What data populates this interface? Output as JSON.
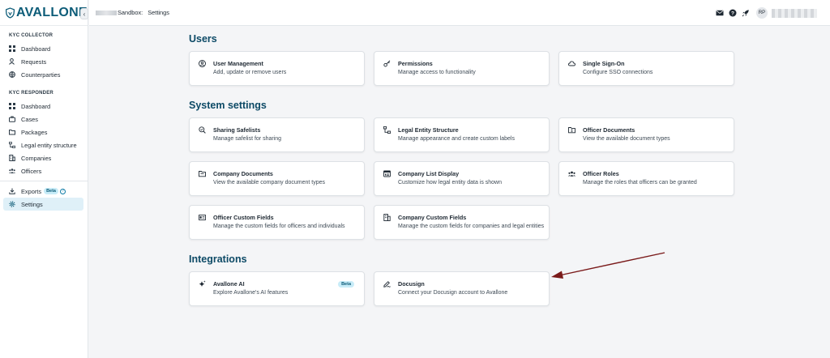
{
  "app": {
    "logo_text": "AVALLONE"
  },
  "sidebar": {
    "collapse_glyph": "‹",
    "sections": [
      {
        "heading": "KYC COLLECTOR",
        "items": [
          {
            "label": "Dashboard",
            "icon": "grid-icon"
          },
          {
            "label": "Requests",
            "icon": "user-request-icon"
          },
          {
            "label": "Counterparties",
            "icon": "globe-icon"
          }
        ]
      },
      {
        "heading": "KYC RESPONDER",
        "items": [
          {
            "label": "Dashboard",
            "icon": "grid-icon"
          },
          {
            "label": "Cases",
            "icon": "briefcase-icon"
          },
          {
            "label": "Packages",
            "icon": "folder-icon"
          },
          {
            "label": "Legal entity structure",
            "icon": "structure-icon"
          },
          {
            "label": "Companies",
            "icon": "building-icon"
          },
          {
            "label": "Officers",
            "icon": "people-icon"
          }
        ]
      }
    ],
    "bottom_items": [
      {
        "label": "Exports",
        "badge": "Beta",
        "help": "?",
        "icon": "download-icon"
      },
      {
        "label": "Settings",
        "icon": "gear-icon",
        "active": true
      }
    ]
  },
  "topbar": {
    "breadcrumb_env": "Sandbox:",
    "breadcrumb_page": "Settings",
    "avatar_initials": "RP"
  },
  "sections": [
    {
      "title": "Users",
      "cards": [
        {
          "title": "User Management",
          "desc": "Add, update or remove users",
          "icon": "user-circle-icon"
        },
        {
          "title": "Permissions",
          "desc": "Manage access to functionality",
          "icon": "key-icon"
        },
        {
          "title": "Single Sign-On",
          "desc": "Configure SSO connections",
          "icon": "cloud-icon"
        }
      ]
    },
    {
      "title": "System settings",
      "cards": [
        {
          "title": "Sharing Safelists",
          "desc": "Manage safelist for sharing",
          "icon": "shield-search-icon"
        },
        {
          "title": "Legal Entity Structure",
          "desc": "Manage appearance and create custom labels",
          "icon": "structure-icon"
        },
        {
          "title": "Officer Documents",
          "desc": "View the available document types",
          "icon": "folder-user-icon"
        },
        {
          "title": "Company Documents",
          "desc": "View the available company document types",
          "icon": "folder-icon"
        },
        {
          "title": "Company List Display",
          "desc": "Customize how legal entity data is shown",
          "icon": "list-display-icon"
        },
        {
          "title": "Officer Roles",
          "desc": "Manage the roles that officers can be granted",
          "icon": "people-icon"
        },
        {
          "title": "Officer Custom Fields",
          "desc": "Manage the custom fields for officers and individuals",
          "icon": "id-card-icon"
        },
        {
          "title": "Company Custom Fields",
          "desc": "Manage the custom fields for companies and legal entities",
          "icon": "building-icon"
        }
      ]
    },
    {
      "title": "Integrations",
      "cards": [
        {
          "title": "Avallone AI",
          "desc": "Explore Avallone's AI features",
          "badge": "Beta",
          "icon": "sparkle-icon"
        },
        {
          "title": "Docusign",
          "desc": "Connect your Docusign account to Avallone",
          "icon": "signature-icon"
        }
      ]
    }
  ],
  "colors": {
    "accent": "#0d5c78",
    "heading": "#0d4a66",
    "active_bg": "#dff0f8",
    "arrow": "#7a1a1a"
  }
}
